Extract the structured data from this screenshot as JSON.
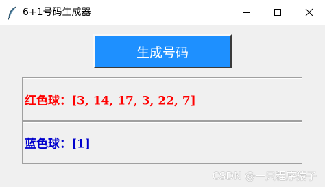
{
  "window": {
    "title": "6+1号码生成器",
    "icon": "feather-icon",
    "controls": {
      "minimize": "minimize-icon",
      "maximize": "maximize-icon",
      "close": "close-icon"
    }
  },
  "main": {
    "generate_button_label": "生成号码",
    "generate_button_color": "#1e90ff",
    "red_ball_text": "红色球：[3, 14, 17, 3, 22, 7]",
    "red_ball_color": "#ff0000",
    "blue_ball_text": "蓝色球：[1]",
    "blue_ball_color": "#0000cd"
  },
  "watermark": "CSDN @一只程序猿子"
}
